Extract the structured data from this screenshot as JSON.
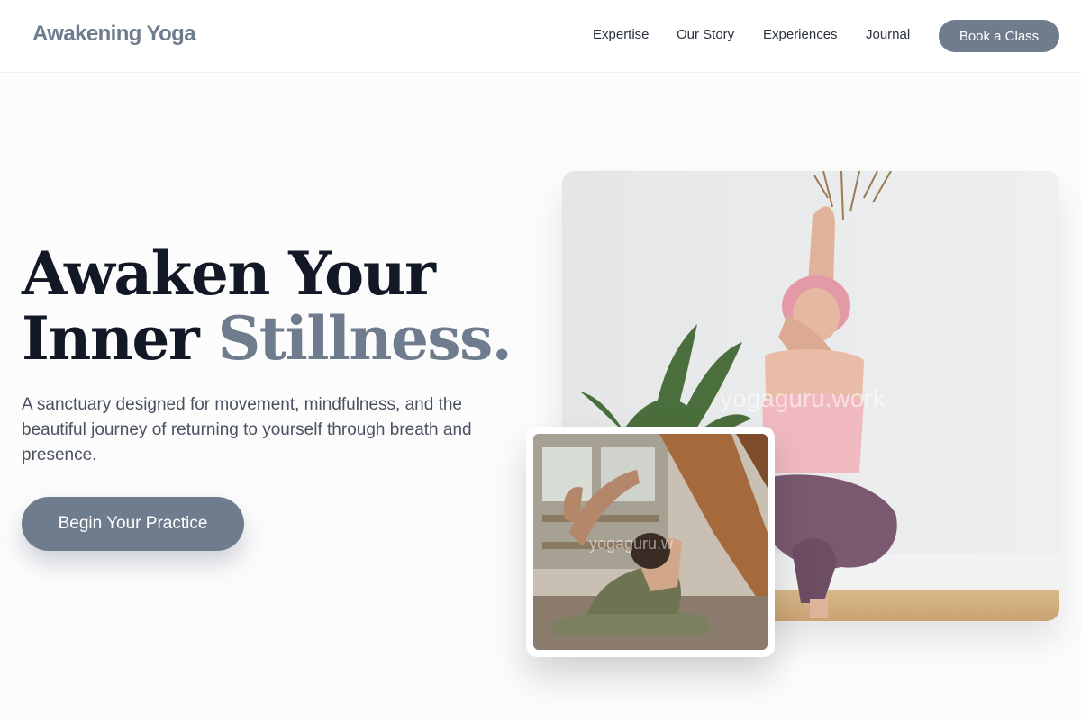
{
  "header": {
    "logo": "Awakening Yoga",
    "nav": [
      {
        "label": "Expertise"
      },
      {
        "label": "Our Story"
      },
      {
        "label": "Experiences"
      },
      {
        "label": "Journal"
      }
    ],
    "cta": "Book a Class"
  },
  "hero": {
    "title_line1": "Awaken Your",
    "title_line2_a": "Inner ",
    "title_line2_accent": "Stillness.",
    "description": "A sanctuary designed for movement, mindfulness, and the beautiful journey of returning to yourself through breath and presence.",
    "cta": "Begin Your Practice"
  },
  "images": {
    "main_watermark": "yogaguru.work",
    "small_watermark": "yogaguru.w"
  },
  "colors": {
    "accent": "#6f7c8e",
    "heading": "#121826",
    "body_text": "#4a5260",
    "background": "#fcfcfc"
  }
}
